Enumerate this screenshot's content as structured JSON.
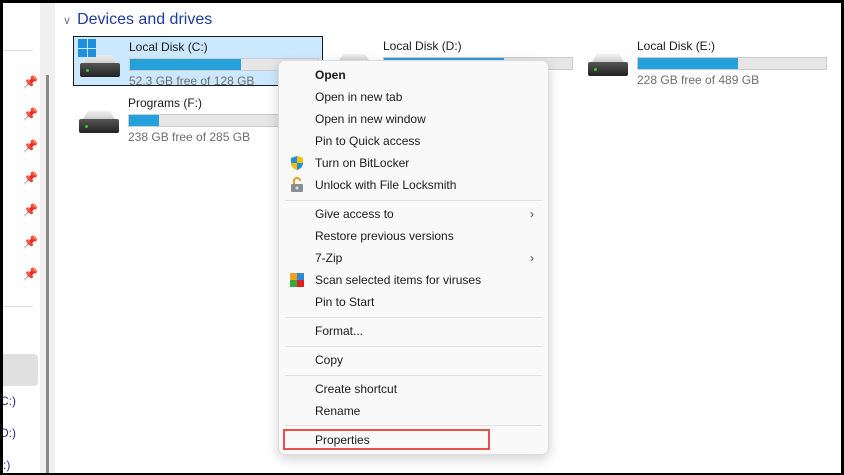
{
  "section": {
    "title": "Devices and drives"
  },
  "drives": [
    {
      "name": "Local Disk (C:)",
      "free": "52.3 GB free of 128 GB",
      "used_pct": 59,
      "selected": true
    },
    {
      "name": "Local Disk (D:)",
      "free": "",
      "used_pct": 64
    },
    {
      "name": "Local Disk (E:)",
      "free": "228 GB free of 489 GB",
      "used_pct": 53
    },
    {
      "name": "Programs (F:)",
      "free": "238 GB free of 285 GB",
      "used_pct": 16
    }
  ],
  "sidebar": {
    "drive_labels": [
      "C:)",
      "D:)",
      ":)"
    ]
  },
  "menu": {
    "open": "Open",
    "open_new_tab": "Open in new tab",
    "open_new_window": "Open in new window",
    "pin_quick": "Pin to Quick access",
    "bitlocker": "Turn on BitLocker",
    "locksmith": "Unlock with File Locksmith",
    "give_access": "Give access to",
    "restore": "Restore previous versions",
    "zip": "7-Zip",
    "scan": "Scan selected items for viruses",
    "pin_start": "Pin to Start",
    "format": "Format...",
    "copy": "Copy",
    "shortcut": "Create shortcut",
    "rename": "Rename",
    "properties": "Properties"
  },
  "colors": {
    "accent": "#26a0da",
    "highlight": "#e8504a"
  }
}
